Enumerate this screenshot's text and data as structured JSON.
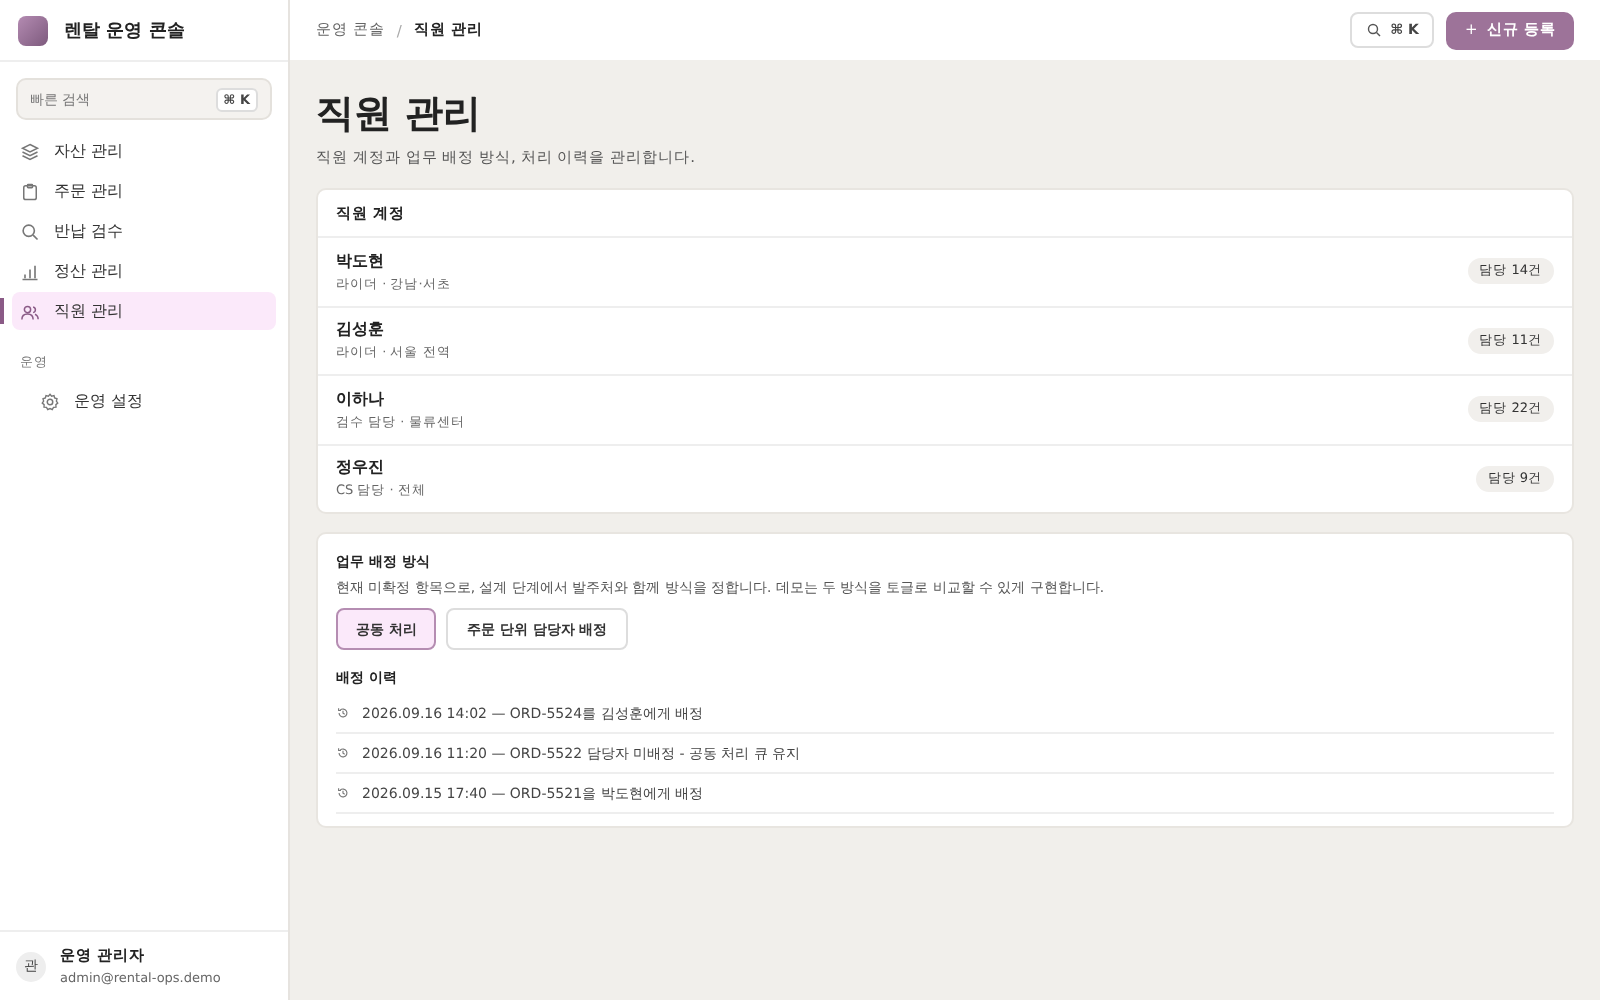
{
  "app": {
    "title": "렌탈 운영 콘솔"
  },
  "quick_search": {
    "placeholder": "빠른 검색",
    "shortcut": "⌘ K"
  },
  "nav": [
    {
      "label": "자산 관리",
      "kind": "layers",
      "selected": false
    },
    {
      "label": "주문 관리",
      "kind": "clipboard",
      "selected": false
    },
    {
      "label": "반납 검수",
      "kind": "search",
      "selected": false
    },
    {
      "label": "정산 관리",
      "kind": "chart",
      "selected": false
    },
    {
      "label": "직원 관리",
      "kind": "people",
      "selected": true
    }
  ],
  "nav_section": {
    "title": "운영",
    "items": [
      {
        "label": "운영 설정",
        "kind": "gear",
        "selected": false
      }
    ]
  },
  "user": {
    "avatar": "관",
    "name": "운영 관리자",
    "email": "admin@rental-ops.demo"
  },
  "breadcrumb": [
    "운영 콘솔",
    "직원 관리"
  ],
  "breadcrumb_separator": "/",
  "header_actions": {
    "search_shortcut": "⌘ K",
    "primary": "신규 등록",
    "primary_icon": "+"
  },
  "page": {
    "title": "직원 관리",
    "description": "직원 계정과 업무 배정 방식, 처리 이력을 관리합니다."
  },
  "staff": {
    "title": "직원 계정",
    "rows": [
      {
        "name": "박도현",
        "detail": "라이더 · 강남·서초",
        "count": "담당 14건"
      },
      {
        "name": "김성훈",
        "detail": "라이더 · 서울 전역",
        "count": "담당 11건"
      },
      {
        "name": "이하나",
        "detail": "검수 담당 · 물류센터",
        "count": "담당 22건"
      },
      {
        "name": "정우진",
        "detail": "CS 담당 · 전체",
        "count": "담당 9건"
      }
    ]
  },
  "assignment": {
    "title": "업무 배정 방식",
    "note": "현재 미확정 항목으로, 설계 단계에서 발주처와 함께 방식을 정합니다. 데모는 두 방식을 토글로 비교할 수 있게 구현합니다.",
    "options": [
      {
        "label": "공동 처리",
        "selected": true
      },
      {
        "label": "주문 단위 담당자 배정",
        "selected": false
      }
    ],
    "history_title": "배정 이력",
    "history": [
      "2026.09.16 14:02 — ORD-5524를 김성훈에게 배정",
      "2026.09.16 11:20 — ORD-5522 담당자 미배정 - 공동 처리 큐 유지",
      "2026.09.15 17:40 — ORD-5521을 박도현에게 배정"
    ]
  }
}
